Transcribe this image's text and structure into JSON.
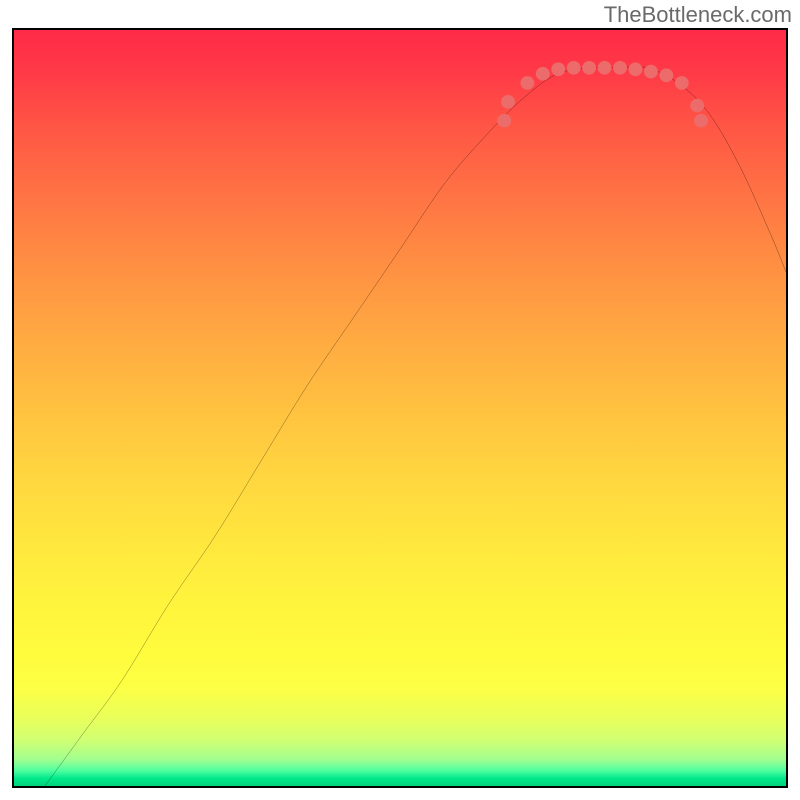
{
  "attribution": "TheBottleneck.com",
  "chart_data": {
    "type": "line",
    "title": "",
    "xlabel": "",
    "ylabel": "",
    "xlim": [
      0,
      100
    ],
    "ylim": [
      0,
      100
    ],
    "grid": false,
    "curve_points_pct": [
      [
        4,
        0
      ],
      [
        9,
        7
      ],
      [
        14,
        14
      ],
      [
        20,
        24
      ],
      [
        26,
        33
      ],
      [
        32,
        43
      ],
      [
        38,
        53
      ],
      [
        44,
        62
      ],
      [
        50,
        71
      ],
      [
        56,
        80
      ],
      [
        62,
        87
      ],
      [
        66,
        91
      ],
      [
        70,
        94
      ],
      [
        74,
        95
      ],
      [
        78,
        95
      ],
      [
        82,
        95
      ],
      [
        86,
        93
      ],
      [
        90,
        89
      ],
      [
        94,
        82
      ],
      [
        98,
        73
      ],
      [
        100,
        68
      ]
    ],
    "markers_pct": [
      [
        63.5,
        88.0
      ],
      [
        64.0,
        90.5
      ],
      [
        66.5,
        93.0
      ],
      [
        68.5,
        94.2
      ],
      [
        70.5,
        94.8
      ],
      [
        72.5,
        95.0
      ],
      [
        74.5,
        95.0
      ],
      [
        76.5,
        95.0
      ],
      [
        78.5,
        95.0
      ],
      [
        80.5,
        94.8
      ],
      [
        82.5,
        94.5
      ],
      [
        84.5,
        94.0
      ],
      [
        86.5,
        93.0
      ],
      [
        88.5,
        90.0
      ],
      [
        89.0,
        88.0
      ]
    ],
    "colors": {
      "curve": "#000000",
      "marker": "#EC6B6B",
      "gradient_top": "#ff2a47",
      "gradient_bottom": "#00d27a"
    }
  }
}
